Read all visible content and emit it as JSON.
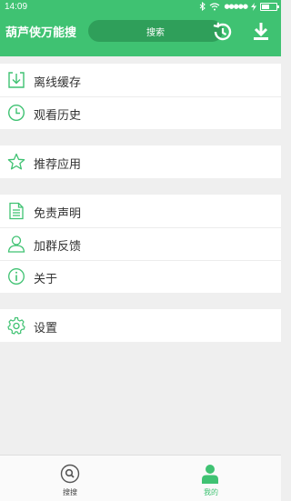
{
  "status_bar": {
    "time": "14:09",
    "signal": "●●●●●",
    "accent_color": "#3fc272"
  },
  "header": {
    "title": "葫芦侠万能搜",
    "search_label": "搜索",
    "history_icon": "history-icon",
    "download_icon": "download-icon"
  },
  "menu": {
    "group1": [
      {
        "label": "离线缓存",
        "icon": "download-box-icon"
      },
      {
        "label": "观看历史",
        "icon": "clock-icon"
      }
    ],
    "group2": [
      {
        "label": "推荐应用",
        "icon": "star-icon"
      }
    ],
    "group3": [
      {
        "label": "免责声明",
        "icon": "document-icon"
      },
      {
        "label": "加群反馈",
        "icon": "person-icon"
      },
      {
        "label": "关于",
        "icon": "info-icon"
      }
    ],
    "group4": [
      {
        "label": "设置",
        "icon": "gear-icon"
      }
    ]
  },
  "tabbar": {
    "tabs": [
      {
        "label": "搜搜",
        "icon": "search-icon",
        "active": false
      },
      {
        "label": "我的",
        "icon": "user-icon",
        "active": true
      }
    ]
  }
}
